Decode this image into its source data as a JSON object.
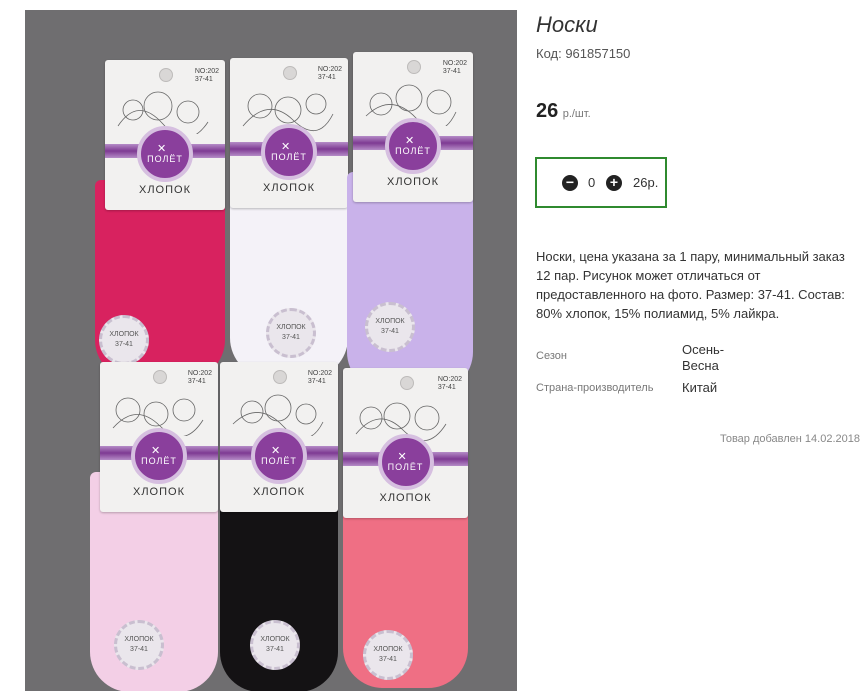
{
  "product": {
    "title": "Носки",
    "code_label": "Код: 961857150",
    "price_value": "26",
    "price_unit": "р./шт.",
    "quantity": "0",
    "quantity_total": "26р.",
    "description": "Носки, цена указана за 1 пару, минимальный заказ 12 пар. Рисунок может отличаться от предоставленного на фото. Размер: 37-41. Состав: 80% хлопок, 15% полиамид, 5% лайкра.",
    "attributes": [
      {
        "name": "Сезон",
        "value": "Осень-Весна"
      },
      {
        "name": "Страна-производитель",
        "value": "Китай"
      }
    ],
    "added": "Товар добавлен 14.02.2018"
  },
  "photo": {
    "brand": "ПОЛЁТ",
    "material": "ХЛОПОК",
    "model_code": "NO:202",
    "size": "37-41",
    "seal_text": "ХЛОПОК",
    "colors": {
      "background": "#6f6e70",
      "sock_1": "#d8225f",
      "sock_2": "#f4f2f8",
      "sock_3": "#c9b2ea",
      "sock_4": "#f3cfe6",
      "sock_5": "#141214",
      "sock_6": "#ef6f84"
    }
  },
  "icons": {
    "minus": "minus-circle-icon",
    "plus": "plus-circle-icon"
  },
  "accent_color": "#2f8a2f"
}
